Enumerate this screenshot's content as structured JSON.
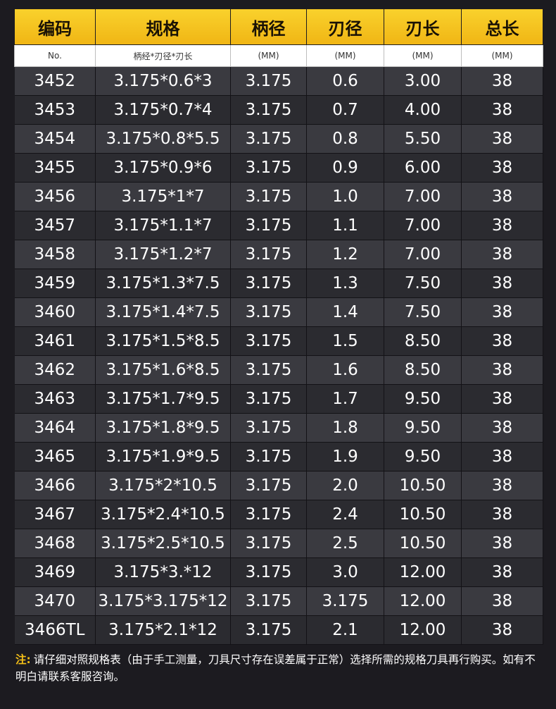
{
  "headers": [
    "编码",
    "规格",
    "柄径",
    "刃径",
    "刃长",
    "总长"
  ],
  "units": [
    "No.",
    "柄经*刃径*刃长",
    "(MM)",
    "(MM)",
    "(MM)",
    "(MM)"
  ],
  "rows": [
    [
      "3452",
      "3.175*0.6*3",
      "3.175",
      "0.6",
      "3.00",
      "38"
    ],
    [
      "3453",
      "3.175*0.7*4",
      "3.175",
      "0.7",
      "4.00",
      "38"
    ],
    [
      "3454",
      "3.175*0.8*5.5",
      "3.175",
      "0.8",
      "5.50",
      "38"
    ],
    [
      "3455",
      "3.175*0.9*6",
      "3.175",
      "0.9",
      "6.00",
      "38"
    ],
    [
      "3456",
      "3.175*1*7",
      "3.175",
      "1.0",
      "7.00",
      "38"
    ],
    [
      "3457",
      "3.175*1.1*7",
      "3.175",
      "1.1",
      "7.00",
      "38"
    ],
    [
      "3458",
      "3.175*1.2*7",
      "3.175",
      "1.2",
      "7.00",
      "38"
    ],
    [
      "3459",
      "3.175*1.3*7.5",
      "3.175",
      "1.3",
      "7.50",
      "38"
    ],
    [
      "3460",
      "3.175*1.4*7.5",
      "3.175",
      "1.4",
      "7.50",
      "38"
    ],
    [
      "3461",
      "3.175*1.5*8.5",
      "3.175",
      "1.5",
      "8.50",
      "38"
    ],
    [
      "3462",
      "3.175*1.6*8.5",
      "3.175",
      "1.6",
      "8.50",
      "38"
    ],
    [
      "3463",
      "3.175*1.7*9.5",
      "3.175",
      "1.7",
      "9.50",
      "38"
    ],
    [
      "3464",
      "3.175*1.8*9.5",
      "3.175",
      "1.8",
      "9.50",
      "38"
    ],
    [
      "3465",
      "3.175*1.9*9.5",
      "3.175",
      "1.9",
      "9.50",
      "38"
    ],
    [
      "3466",
      "3.175*2*10.5",
      "3.175",
      "2.0",
      "10.50",
      "38"
    ],
    [
      "3467",
      "3.175*2.4*10.5",
      "3.175",
      "2.4",
      "10.50",
      "38"
    ],
    [
      "3468",
      "3.175*2.5*10.5",
      "3.175",
      "2.5",
      "10.50",
      "38"
    ],
    [
      "3469",
      "3.175*3.*12",
      "3.175",
      "3.0",
      "12.00",
      "38"
    ],
    [
      "3470",
      "3.175*3.175*12",
      "3.175",
      "3.175",
      "12.00",
      "38"
    ],
    [
      "3466TL",
      "3.175*2.1*12",
      "3.175",
      "2.1",
      "12.00",
      "38"
    ]
  ],
  "note": {
    "label": "注:",
    "text": "请仔细对照规格表（由于手工测量，刀具尺寸存在误差属于正常）选择所需的规格刀具再行购买。如有不明白请联系客服咨询。"
  },
  "colors": {
    "header_yellow": "#f5c018",
    "background": "#1c1b20",
    "row_light": "#3a3a40",
    "row_dark": "#2b2b30"
  }
}
